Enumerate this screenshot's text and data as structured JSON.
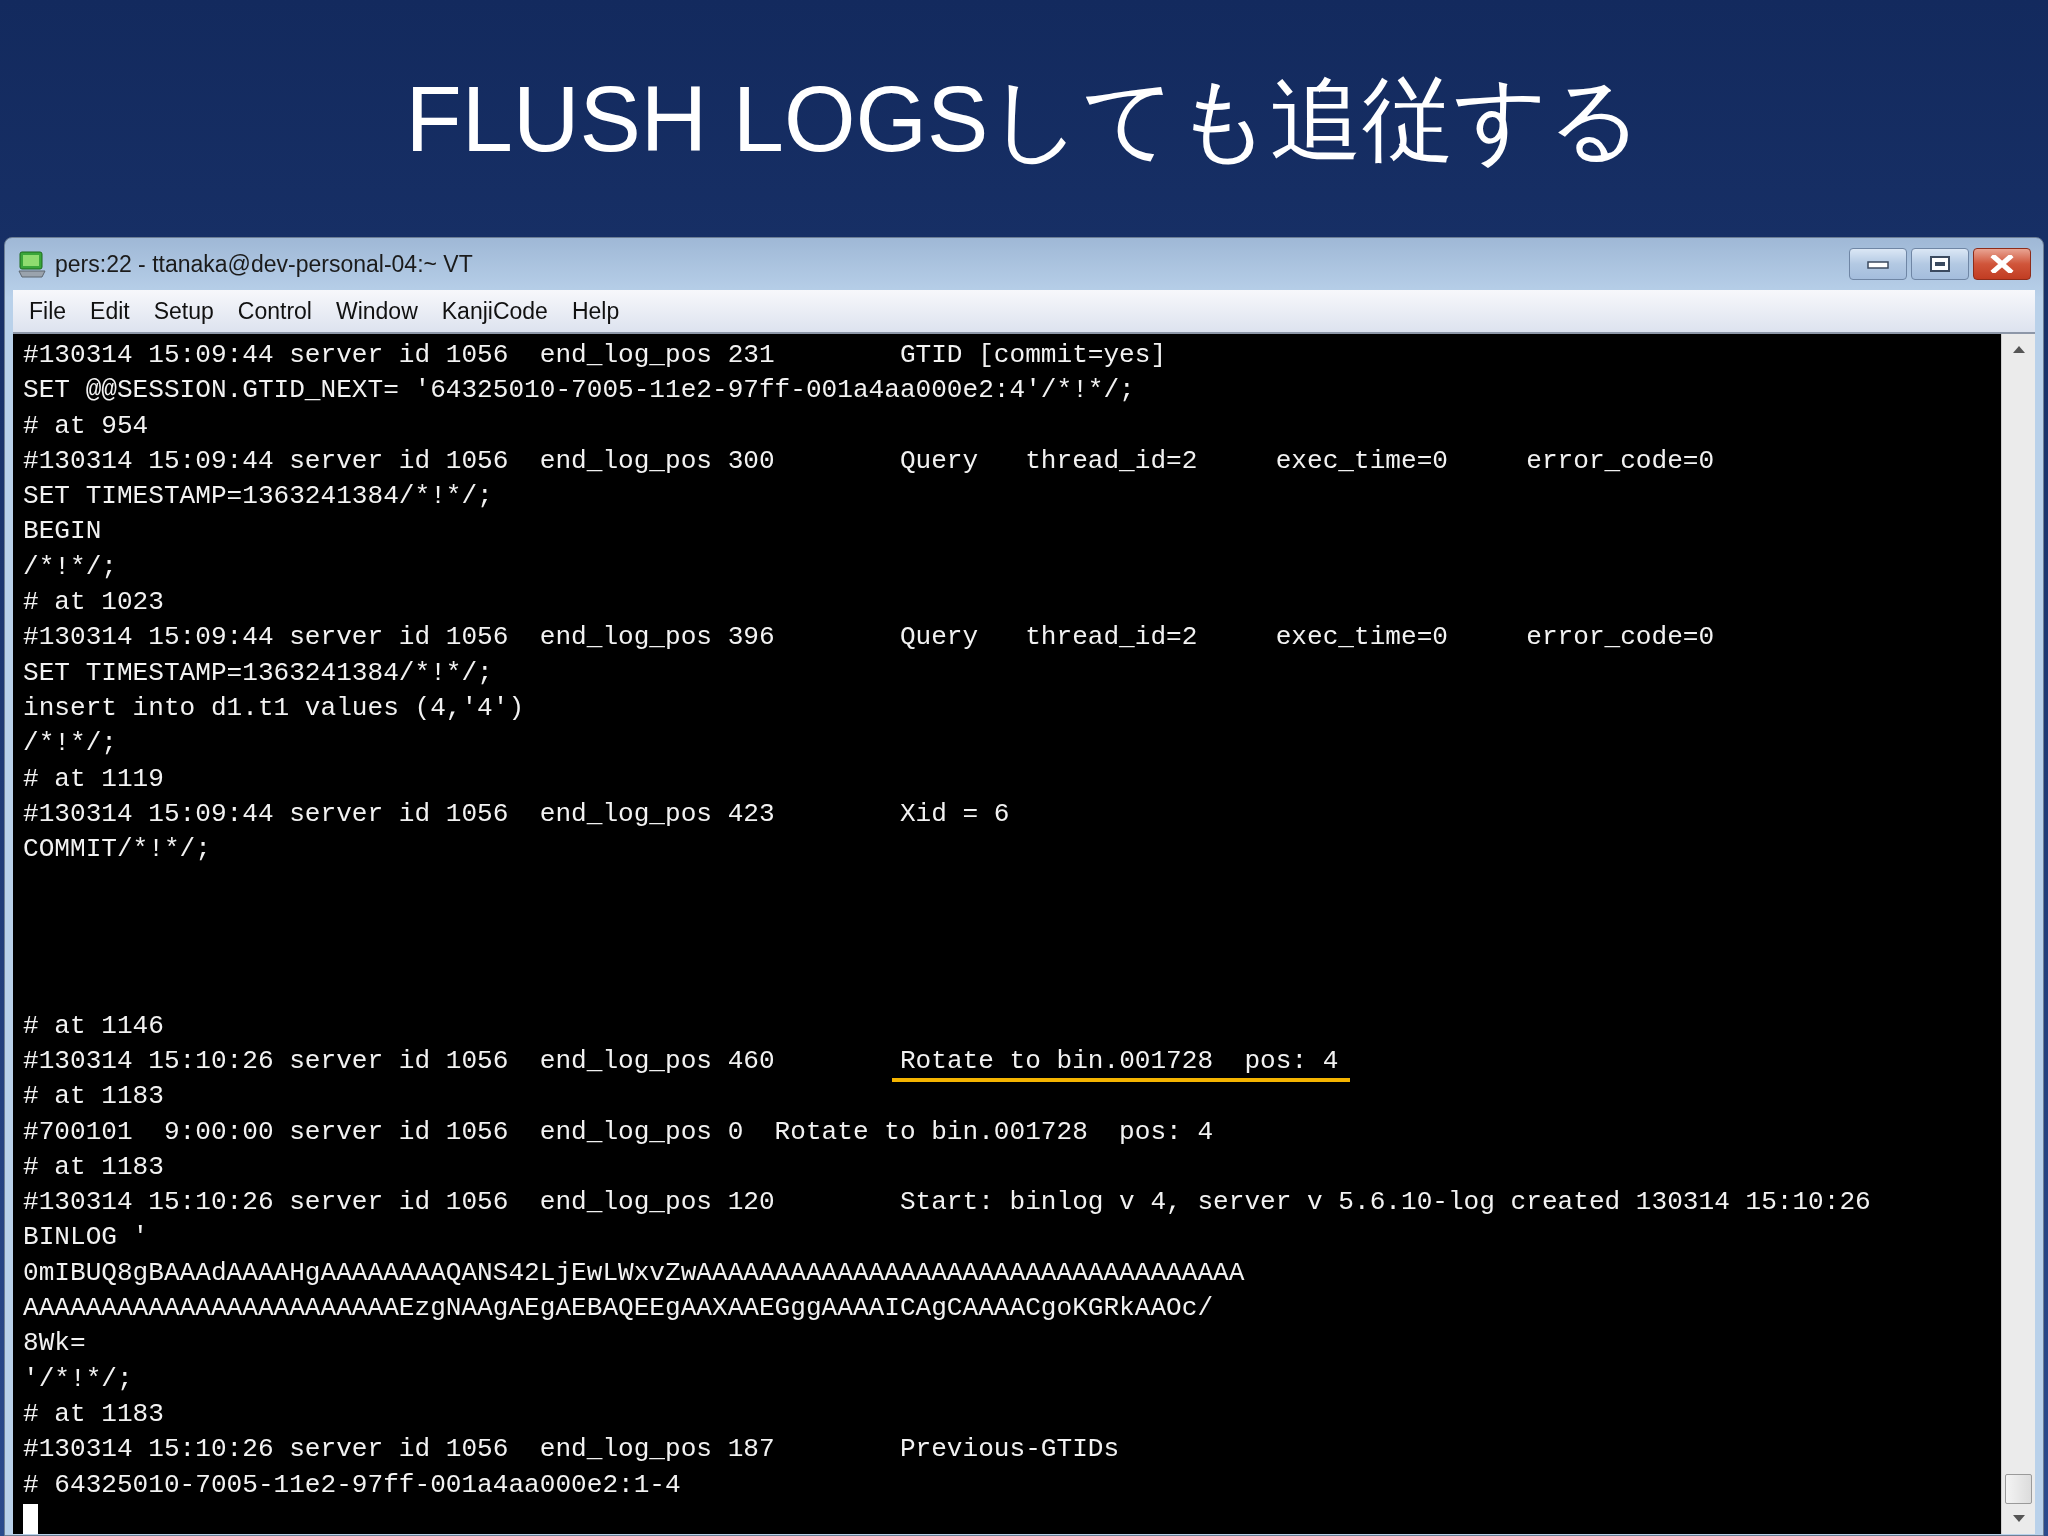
{
  "slide": {
    "title": "FLUSH LOGSしても追従する"
  },
  "window": {
    "title": "pers:22 - ttanaka@dev-personal-04:~ VT"
  },
  "menu": [
    {
      "label": "File"
    },
    {
      "label": "Edit"
    },
    {
      "label": "Setup"
    },
    {
      "label": "Control"
    },
    {
      "label": "Window"
    },
    {
      "label": "KanjiCode"
    },
    {
      "label": "Help"
    }
  ],
  "terminal": {
    "lines": [
      {
        "kind": "text",
        "text": "#130314 15:09:44 server id 1056  end_log_pos 231        GTID [commit=yes]"
      },
      {
        "kind": "text",
        "text": "SET @@SESSION.GTID_NEXT= '64325010-7005-11e2-97ff-001a4aa000e2:4'/*!*/;"
      },
      {
        "kind": "text",
        "text": "# at 954"
      },
      {
        "kind": "text",
        "text": "#130314 15:09:44 server id 1056  end_log_pos 300        Query   thread_id=2     exec_time=0     error_code=0"
      },
      {
        "kind": "text",
        "text": "SET TIMESTAMP=1363241384/*!*/;"
      },
      {
        "kind": "text",
        "text": "BEGIN"
      },
      {
        "kind": "text",
        "text": "/*!*/;"
      },
      {
        "kind": "text",
        "text": "# at 1023"
      },
      {
        "kind": "text",
        "text": "#130314 15:09:44 server id 1056  end_log_pos 396        Query   thread_id=2     exec_time=0     error_code=0"
      },
      {
        "kind": "text",
        "text": "SET TIMESTAMP=1363241384/*!*/;"
      },
      {
        "kind": "text",
        "text": "insert into d1.t1 values (4,'4')"
      },
      {
        "kind": "text",
        "text": "/*!*/;"
      },
      {
        "kind": "text",
        "text": "# at 1119"
      },
      {
        "kind": "text",
        "text": "#130314 15:09:44 server id 1056  end_log_pos 423        Xid = 6"
      },
      {
        "kind": "text",
        "text": "COMMIT/*!*/;"
      },
      {
        "kind": "blank"
      },
      {
        "kind": "blank"
      },
      {
        "kind": "blank"
      },
      {
        "kind": "blank"
      },
      {
        "kind": "text",
        "text": "# at 1146"
      },
      {
        "kind": "marked",
        "text": "#130314 15:10:26 server id 1056  end_log_pos 460",
        "marked": "Rotate to bin.001728  pos: 4"
      },
      {
        "kind": "text",
        "text": "# at 1183"
      },
      {
        "kind": "text",
        "text": "#700101  9:00:00 server id 1056  end_log_pos 0  Rotate to bin.001728  pos: 4"
      },
      {
        "kind": "text",
        "text": "# at 1183"
      },
      {
        "kind": "text",
        "text": "#130314 15:10:26 server id 1056  end_log_pos 120        Start: binlog v 4, server v 5.6.10-log created 130314 15:10:26"
      },
      {
        "kind": "text",
        "text": "BINLOG '"
      },
      {
        "kind": "text",
        "text": "0mIBUQ8gBAAAdAAAAHgAAAAAAAAQANS42LjEwLWxvZwAAAAAAAAAAAAAAAAAAAAAAAAAAAAAAAAAAA"
      },
      {
        "kind": "text",
        "text": "AAAAAAAAAAAAAAAAAAAAAAAAEzgNAAgAEgAEBAQEEgAAXAAEGggAAAAICAgCAAAACgoKGRkAAOc/"
      },
      {
        "kind": "text",
        "text": "8Wk="
      },
      {
        "kind": "text",
        "text": "'/*!*/;"
      },
      {
        "kind": "text",
        "text": "# at 1183"
      },
      {
        "kind": "text",
        "text": "#130314 15:10:26 server id 1056  end_log_pos 187        Previous-GTIDs"
      },
      {
        "kind": "text",
        "text": "# 64325010-7005-11e2-97ff-001a4aa000e2:1-4"
      },
      {
        "kind": "cursor"
      }
    ]
  }
}
